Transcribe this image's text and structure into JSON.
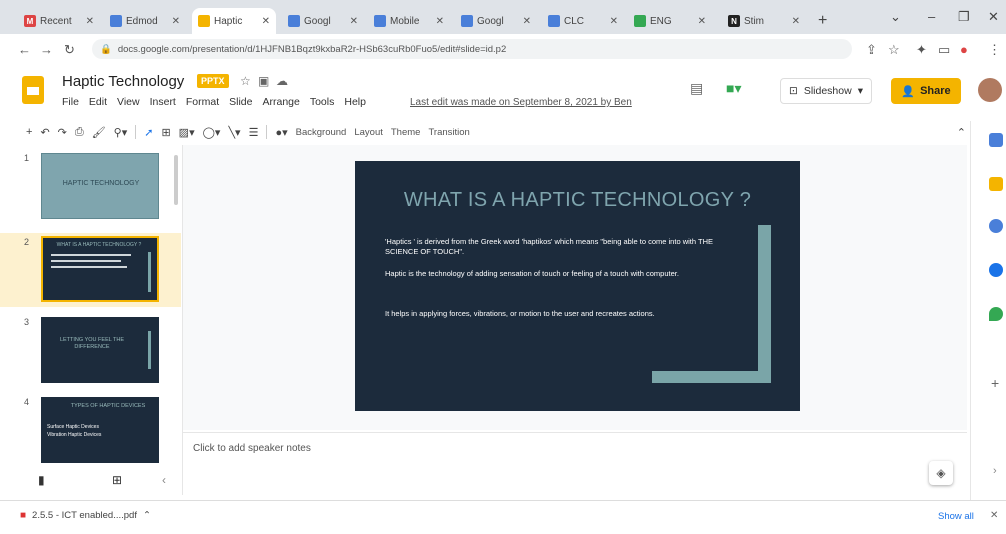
{
  "browser": {
    "tabs": [
      {
        "label": "Recent",
        "icon": "gmail-icon",
        "active": false
      },
      {
        "label": "Edmod",
        "icon": "docs-icon",
        "active": false
      },
      {
        "label": "Haptic",
        "icon": "slides-icon",
        "active": true
      },
      {
        "label": "Googl",
        "icon": "docs-icon",
        "active": false
      },
      {
        "label": "Mobile",
        "icon": "slides-icon",
        "active": false
      },
      {
        "label": "Googl",
        "icon": "docs-icon",
        "active": false
      },
      {
        "label": "CLC",
        "icon": "docs-icon",
        "active": false
      },
      {
        "label": "ENG",
        "icon": "drive-icon",
        "active": false
      },
      {
        "label": "Stim",
        "icon": "notion-icon",
        "active": false
      }
    ],
    "url": "docs.google.com/presentation/d/1HJFNB1Bqzt9kxbaR2r-HSb63cuRb0Fuo5/edit#slide=id.p2"
  },
  "doc": {
    "title": "Haptic Technology",
    "badge": "PPTX",
    "menus": [
      "File",
      "Edit",
      "View",
      "Insert",
      "Format",
      "Slide",
      "Arrange",
      "Tools",
      "Help"
    ],
    "last_edit": "Last edit was made on September 8, 2021 by Ben",
    "slideshow_label": "Slideshow",
    "share_label": "Share"
  },
  "toolbar": {
    "background": "Background",
    "layout": "Layout",
    "theme": "Theme",
    "transition": "Transition"
  },
  "filmstrip": {
    "slides": [
      {
        "number": "1",
        "title": "HAPTIC TECHNOLOGY"
      },
      {
        "number": "2",
        "title": "WHAT IS A HAPTIC TECHNOLOGY ?"
      },
      {
        "number": "3",
        "title": "LETTING YOU FEEL THE DIFFERENCE"
      },
      {
        "number": "4",
        "title": "TYPES OF HAPTIC DEVICES",
        "lines": [
          "Surface Haptic Devices",
          "Vibration Haptic Devices"
        ]
      }
    ]
  },
  "slide": {
    "title": "WHAT IS A HAPTIC TECHNOLOGY ?",
    "paragraphs": [
      "'Haptics ' is derived from the Greek word 'haptikos' which means \"being able to come into with THE SCIENCE OF TOUCH\".",
      "Haptic is the technology of adding sensation of touch or feeling of a touch with computer.",
      "It helps in applying forces, vibrations, or motion to the user and recreates actions."
    ]
  },
  "notes": {
    "placeholder": "Click to add speaker notes"
  },
  "downloads": {
    "file": "2.5.5 - ICT enabled....pdf",
    "show_all": "Show all"
  },
  "colors": {
    "accent": "#f4b400",
    "slide_bg": "#1c2b3c",
    "slide_accent": "#7aa5a8"
  }
}
